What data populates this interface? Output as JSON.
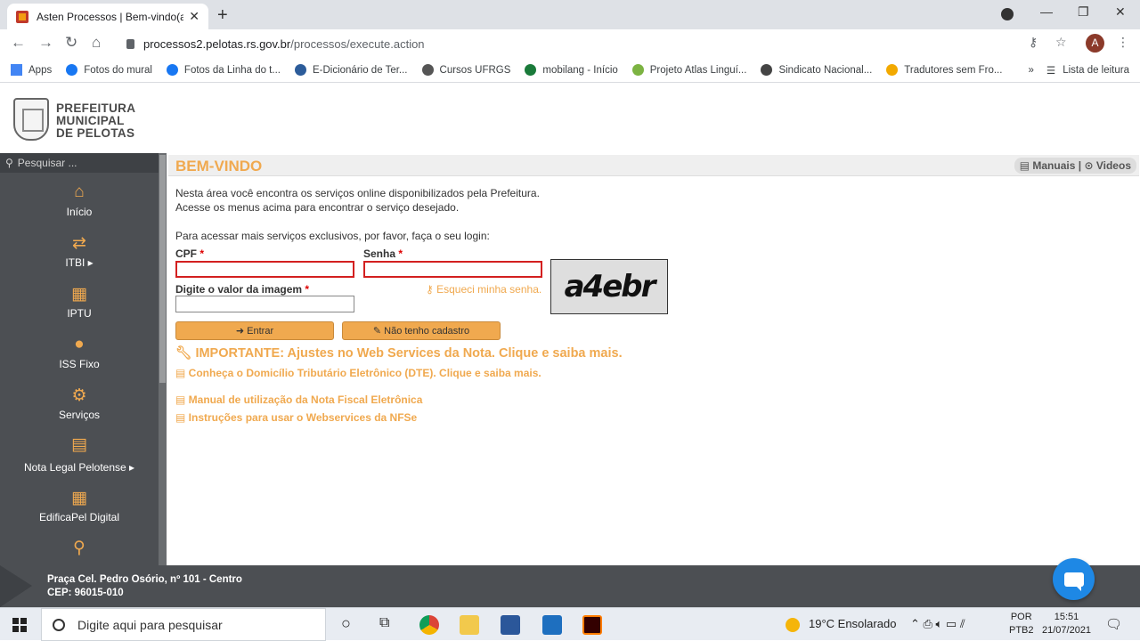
{
  "browser": {
    "tab_title": "Asten Processos | Bem-vindo(a)",
    "tab_close": "✕",
    "new_tab": "+",
    "url_host": "processos2.pelotas.rs.gov.br",
    "url_path": "/processos/execute.action",
    "profile_initial": "A",
    "bookmarks": [
      {
        "label": "Apps",
        "color": "#4285f4"
      },
      {
        "label": "Fotos do mural",
        "color": "#1877f2"
      },
      {
        "label": "Fotos da Linha do t...",
        "color": "#1877f2"
      },
      {
        "label": "E-Dicionário de Ter...",
        "color": "#2c5c9a"
      },
      {
        "label": "Cursos UFRGS",
        "color": "#555555"
      },
      {
        "label": "mobilang - Início",
        "color": "#1a7a3a"
      },
      {
        "label": "Projeto Atlas Linguí...",
        "color": "#7cb342"
      },
      {
        "label": "Sindicato Nacional...",
        "color": "#444444"
      },
      {
        "label": "Tradutores sem Fro...",
        "color": "#f2a900"
      }
    ],
    "bookmarks_more": "»",
    "reading_list": "Lista de leitura"
  },
  "site": {
    "brand_line1": "PREFEITURA",
    "brand_line2": "MUNICIPAL",
    "brand_line3": "DE PELOTAS",
    "search_placeholder": "Pesquisar ...",
    "menu": [
      {
        "label": "Início",
        "icon": "home-icon",
        "glyph": "⌂"
      },
      {
        "label": "ITBI ▸",
        "icon": "transfer-icon",
        "glyph": "⇄"
      },
      {
        "label": "IPTU",
        "icon": "building-icon",
        "glyph": "▦"
      },
      {
        "label": "ISS Fixo",
        "icon": "user-icon",
        "glyph": "●"
      },
      {
        "label": "Serviços",
        "icon": "gears-icon",
        "glyph": "⚙"
      },
      {
        "label": "Nota Legal Pelotense ▸",
        "icon": "nota-legal-icon",
        "glyph": "▤"
      },
      {
        "label": "EdificaPel Digital",
        "icon": "edifica-icon",
        "glyph": "▦"
      },
      {
        "label": "",
        "icon": "search-icon",
        "glyph": "⚲"
      }
    ],
    "accent_color": "#f0a94f"
  },
  "main": {
    "title": "BEM-VINDO",
    "manuais": "Manuais",
    "videos": "Videos",
    "intro1": "Nesta área você encontra os serviços online disponibilizados pela Prefeitura.",
    "intro2": "Acesse os menus acima para encontrar o serviço desejado.",
    "login_prompt": "Para acessar mais serviços exclusivos, por favor, faça o seu login:",
    "cpf_label": "CPF",
    "senha_label": "Senha",
    "captcha_label": "Digite o valor da imagem",
    "required_mark": "*",
    "forgot": "Esqueci minha senha.",
    "captcha_text": "a4ebr",
    "enter_button": "➜ Entrar",
    "register_button": "✎ Não tenho cadastro",
    "important": "IMPORTANTE: Ajustes no Web Services da Nota. Clique e saiba mais.",
    "dte": "Conheça o Domicílio Tributário Eletrônico (DTE). Clique e saiba mais.",
    "manual_nfe": "Manual de utilização da Nota Fiscal Eletrônica",
    "instructions_nfse": "Instruções para usar o Webservices da NFSe"
  },
  "footer": {
    "address1": "Praça Cel. Pedro Osório, nº 101 - Centro",
    "address2": "CEP: 96015-010"
  },
  "taskbar": {
    "search_placeholder": "Digite aqui para pesquisar",
    "weather": "19°C  Ensolarado",
    "lang1": "POR",
    "lang2": "PTB2",
    "time": "15:51",
    "date": "21/07/2021"
  }
}
